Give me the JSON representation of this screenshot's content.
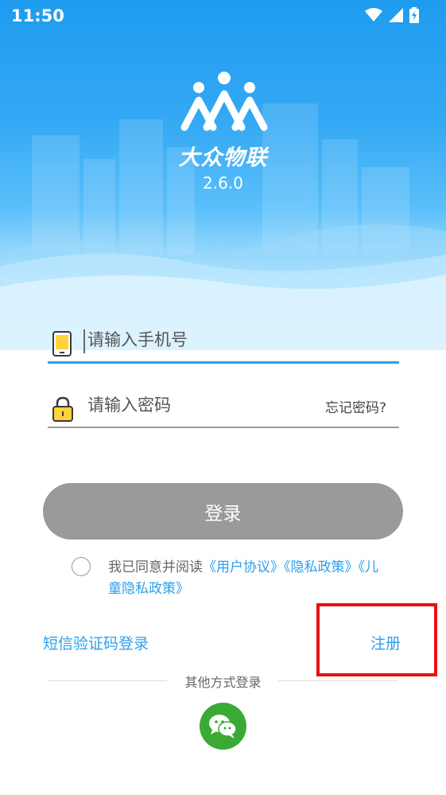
{
  "status": {
    "time": "11:50"
  },
  "brand": {
    "name": "大众物联",
    "version": "2.6.0"
  },
  "form": {
    "phone_placeholder": "请输入手机号",
    "password_placeholder": "请输入密码",
    "forgot_label": "忘记密码?",
    "login_label": "登录"
  },
  "agreement": {
    "prefix": "我已同意并阅读",
    "user_agreement": "《用户协议》",
    "privacy_policy": "《隐私政策》",
    "child_privacy_policy": "《儿童隐私政策》"
  },
  "links": {
    "sms_login": "短信验证码登录",
    "register": "注册"
  },
  "other_login": {
    "label": "其他方式登录",
    "wechat_icon": "wechat-icon"
  },
  "colors": {
    "primary": "#2b9fec",
    "button_disabled": "#9a9a9a",
    "wechat": "#3aaa35",
    "highlight": "#e81010"
  }
}
